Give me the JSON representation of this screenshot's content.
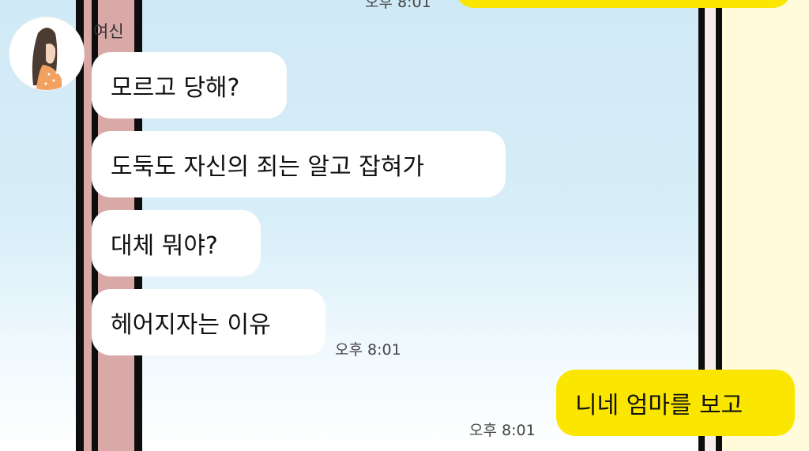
{
  "chat": {
    "sender_name": "여신",
    "top_time": "오후 8:01",
    "messages": [
      {
        "text": "모르고 당해?"
      },
      {
        "text": "도둑도 자신의 죄는 알고 잡혀가"
      },
      {
        "text": "대체 뭐야?"
      },
      {
        "text": "헤어지자는 이유"
      }
    ],
    "received_time": "오후 8:01",
    "sent": {
      "text": "니네 엄마를 보고",
      "time": "오후 8:01"
    }
  },
  "colors": {
    "my_bubble": "#fbe600",
    "their_bubble": "#ffffff",
    "background_top": "#cfe9f6"
  }
}
